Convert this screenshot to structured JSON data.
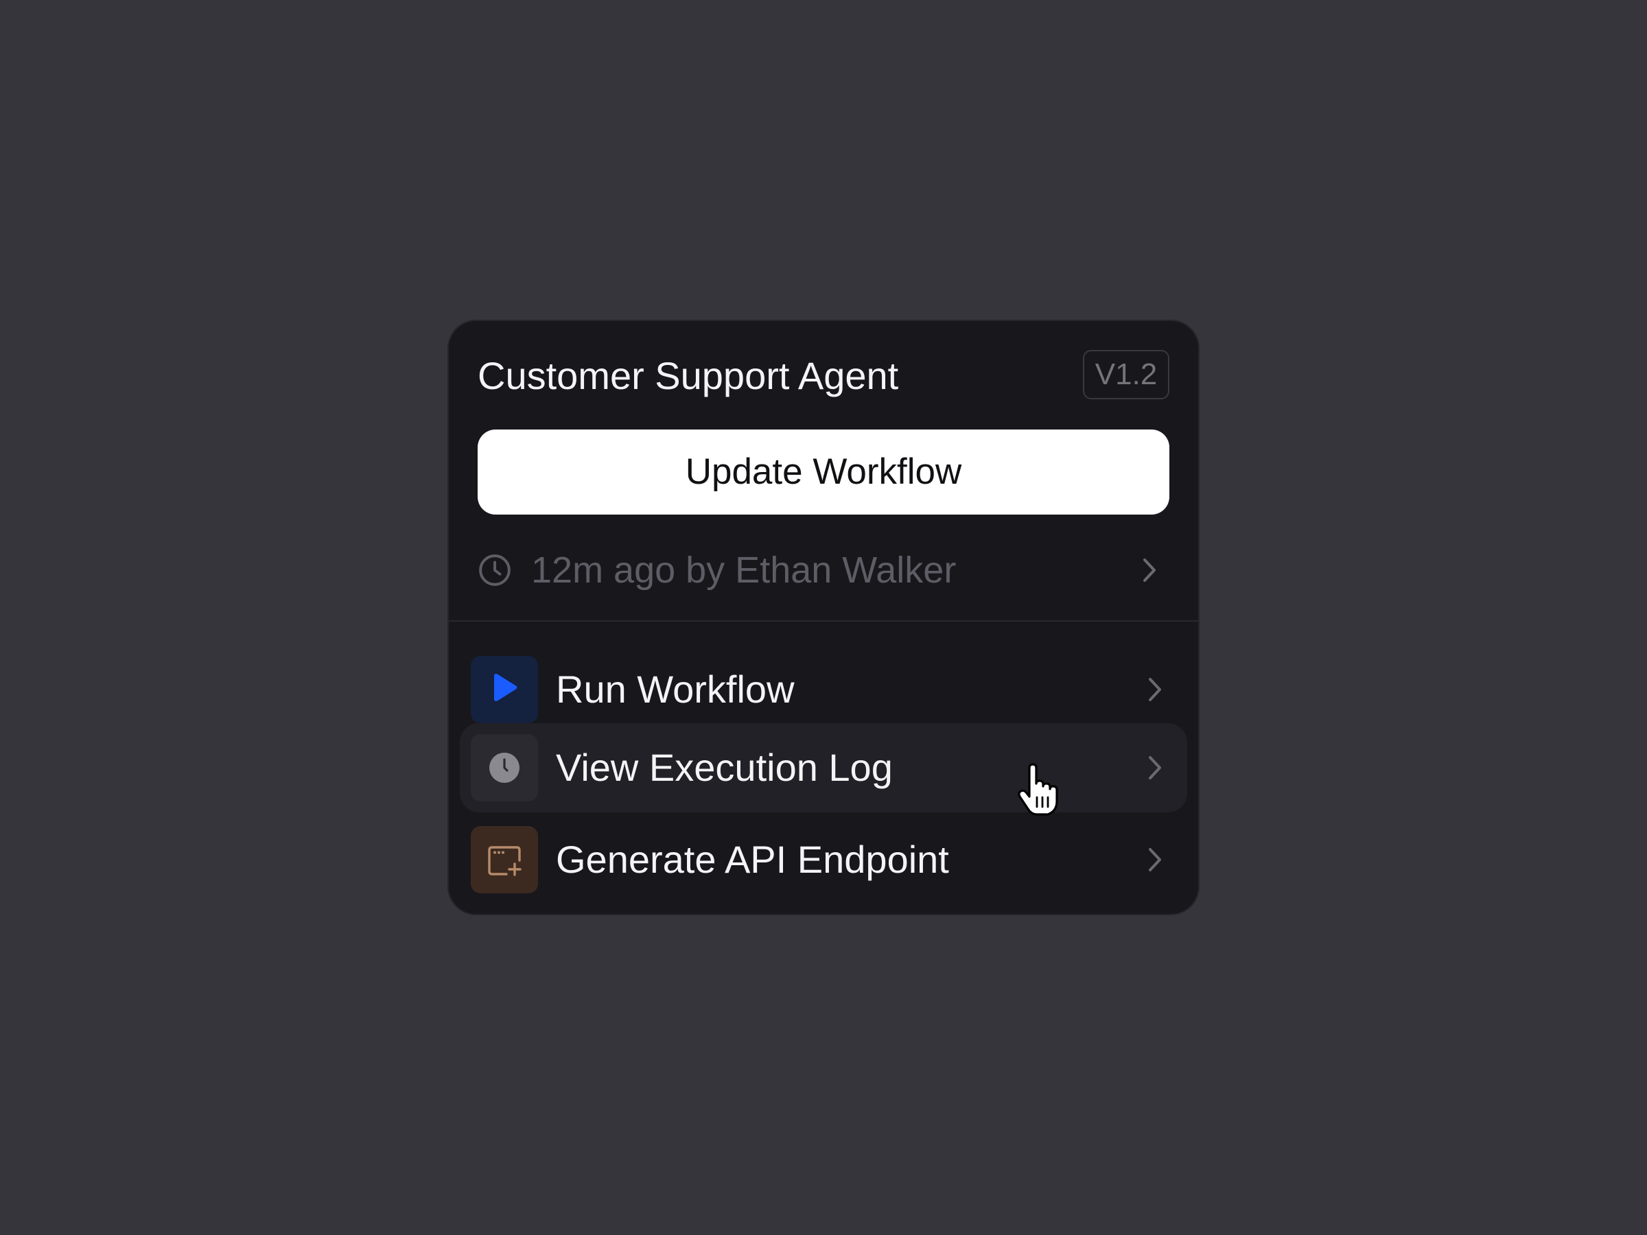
{
  "card": {
    "title": "Customer Support Agent",
    "version": "V1.2",
    "update_button_label": "Update Workflow",
    "history": {
      "text": "12m ago by Ethan Walker",
      "icon": "clock-icon"
    }
  },
  "menu": {
    "items": [
      {
        "label": "Run Workflow",
        "icon": "play-icon",
        "icon_color": "#1a5cff",
        "icon_bg": "#14213f"
      },
      {
        "label": "View Execution Log",
        "icon": "clock-filled-icon",
        "icon_color": "#8a8990",
        "icon_bg": "#2b2a30",
        "state": "hover"
      },
      {
        "label": "Generate API Endpoint",
        "icon": "window-sparkle-icon",
        "icon_color": "#b78a6a",
        "icon_bg": "#3c2a20"
      }
    ]
  },
  "colors": {
    "background": "#36353b",
    "card": "#18171c",
    "button": "#ffffff",
    "muted_text": "#5e5d65"
  }
}
